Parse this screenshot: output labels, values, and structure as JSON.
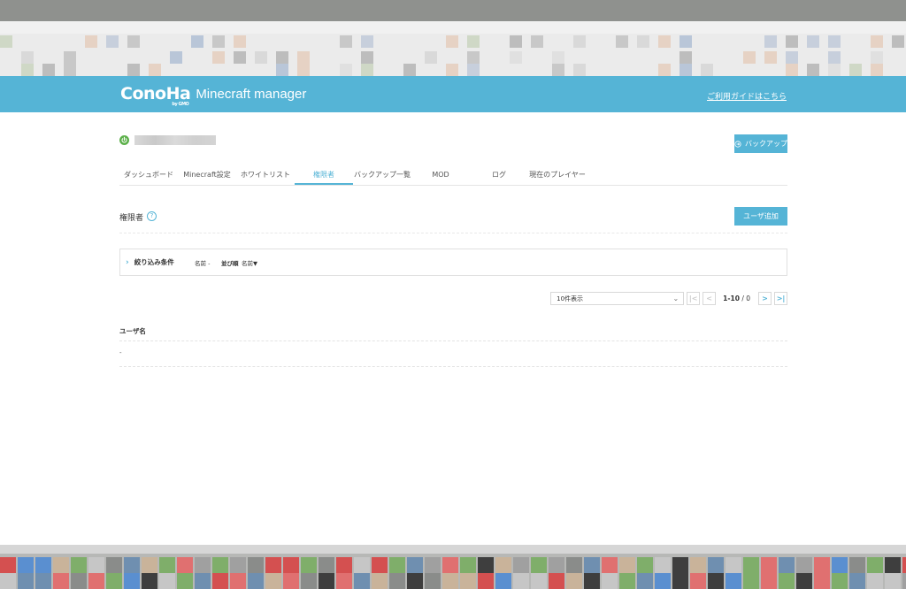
{
  "header": {
    "logo_text": "ConoHa",
    "logo_sub": "by GMO",
    "app_title": "Minecraft manager",
    "guide_link": "ご利用ガイドはこちら",
    "accent": "#55b4d6"
  },
  "server": {
    "status_icon": "power-icon",
    "status_color": "#5cb04a",
    "backup_button": "バックアップ"
  },
  "tabs": [
    {
      "label": "ダッシュボード",
      "active": false
    },
    {
      "label": "Minecraft設定",
      "active": false
    },
    {
      "label": "ホワイトリスト",
      "active": false
    },
    {
      "label": "権限者",
      "active": true
    },
    {
      "label": "バックアップ一覧",
      "active": false
    },
    {
      "label": "MOD",
      "active": false
    },
    {
      "label": "ログ",
      "active": false
    },
    {
      "label": "現在のプレイヤー",
      "active": false
    }
  ],
  "section": {
    "title": "権限者",
    "help_icon": "question-circle-icon",
    "add_user_button": "ユーザ追加"
  },
  "filter": {
    "label": "絞り込み条件",
    "name_field": "名前 -",
    "sort_label": "並び順",
    "sort_value": "名前▼"
  },
  "pager": {
    "per_page": "10件表示",
    "range": "1-10",
    "total": "/ 0",
    "first": "|<",
    "prev": "<",
    "next": ">",
    "last": ">|"
  },
  "table": {
    "columns": [
      "ユーザ名"
    ],
    "rows": [
      [
        "-"
      ]
    ]
  }
}
